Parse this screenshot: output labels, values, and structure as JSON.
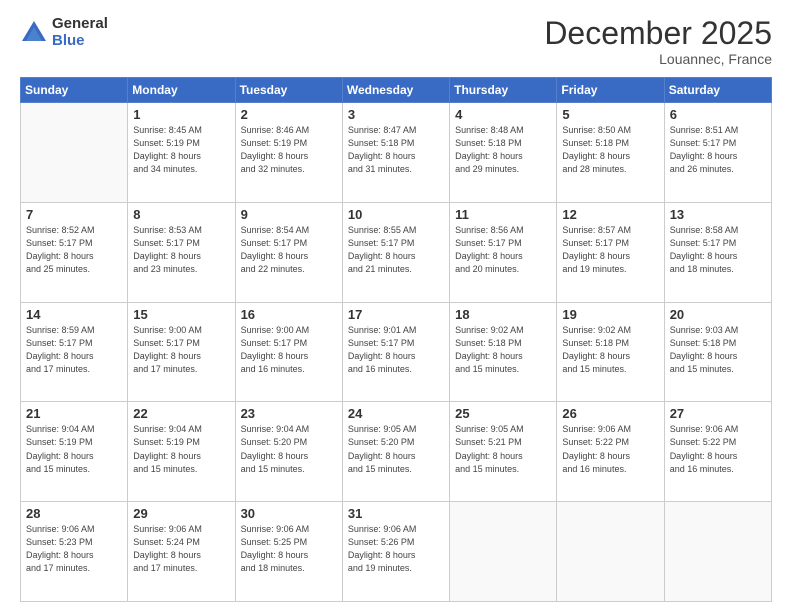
{
  "logo": {
    "general": "General",
    "blue": "Blue"
  },
  "header": {
    "month": "December 2025",
    "location": "Louannec, France"
  },
  "weekdays": [
    "Sunday",
    "Monday",
    "Tuesday",
    "Wednesday",
    "Thursday",
    "Friday",
    "Saturday"
  ],
  "rows": [
    [
      {
        "day": "",
        "info": ""
      },
      {
        "day": "1",
        "info": "Sunrise: 8:45 AM\nSunset: 5:19 PM\nDaylight: 8 hours\nand 34 minutes."
      },
      {
        "day": "2",
        "info": "Sunrise: 8:46 AM\nSunset: 5:19 PM\nDaylight: 8 hours\nand 32 minutes."
      },
      {
        "day": "3",
        "info": "Sunrise: 8:47 AM\nSunset: 5:18 PM\nDaylight: 8 hours\nand 31 minutes."
      },
      {
        "day": "4",
        "info": "Sunrise: 8:48 AM\nSunset: 5:18 PM\nDaylight: 8 hours\nand 29 minutes."
      },
      {
        "day": "5",
        "info": "Sunrise: 8:50 AM\nSunset: 5:18 PM\nDaylight: 8 hours\nand 28 minutes."
      },
      {
        "day": "6",
        "info": "Sunrise: 8:51 AM\nSunset: 5:17 PM\nDaylight: 8 hours\nand 26 minutes."
      }
    ],
    [
      {
        "day": "7",
        "info": "Sunrise: 8:52 AM\nSunset: 5:17 PM\nDaylight: 8 hours\nand 25 minutes."
      },
      {
        "day": "8",
        "info": "Sunrise: 8:53 AM\nSunset: 5:17 PM\nDaylight: 8 hours\nand 23 minutes."
      },
      {
        "day": "9",
        "info": "Sunrise: 8:54 AM\nSunset: 5:17 PM\nDaylight: 8 hours\nand 22 minutes."
      },
      {
        "day": "10",
        "info": "Sunrise: 8:55 AM\nSunset: 5:17 PM\nDaylight: 8 hours\nand 21 minutes."
      },
      {
        "day": "11",
        "info": "Sunrise: 8:56 AM\nSunset: 5:17 PM\nDaylight: 8 hours\nand 20 minutes."
      },
      {
        "day": "12",
        "info": "Sunrise: 8:57 AM\nSunset: 5:17 PM\nDaylight: 8 hours\nand 19 minutes."
      },
      {
        "day": "13",
        "info": "Sunrise: 8:58 AM\nSunset: 5:17 PM\nDaylight: 8 hours\nand 18 minutes."
      }
    ],
    [
      {
        "day": "14",
        "info": "Sunrise: 8:59 AM\nSunset: 5:17 PM\nDaylight: 8 hours\nand 17 minutes."
      },
      {
        "day": "15",
        "info": "Sunrise: 9:00 AM\nSunset: 5:17 PM\nDaylight: 8 hours\nand 17 minutes."
      },
      {
        "day": "16",
        "info": "Sunrise: 9:00 AM\nSunset: 5:17 PM\nDaylight: 8 hours\nand 16 minutes."
      },
      {
        "day": "17",
        "info": "Sunrise: 9:01 AM\nSunset: 5:17 PM\nDaylight: 8 hours\nand 16 minutes."
      },
      {
        "day": "18",
        "info": "Sunrise: 9:02 AM\nSunset: 5:18 PM\nDaylight: 8 hours\nand 15 minutes."
      },
      {
        "day": "19",
        "info": "Sunrise: 9:02 AM\nSunset: 5:18 PM\nDaylight: 8 hours\nand 15 minutes."
      },
      {
        "day": "20",
        "info": "Sunrise: 9:03 AM\nSunset: 5:18 PM\nDaylight: 8 hours\nand 15 minutes."
      }
    ],
    [
      {
        "day": "21",
        "info": "Sunrise: 9:04 AM\nSunset: 5:19 PM\nDaylight: 8 hours\nand 15 minutes."
      },
      {
        "day": "22",
        "info": "Sunrise: 9:04 AM\nSunset: 5:19 PM\nDaylight: 8 hours\nand 15 minutes."
      },
      {
        "day": "23",
        "info": "Sunrise: 9:04 AM\nSunset: 5:20 PM\nDaylight: 8 hours\nand 15 minutes."
      },
      {
        "day": "24",
        "info": "Sunrise: 9:05 AM\nSunset: 5:20 PM\nDaylight: 8 hours\nand 15 minutes."
      },
      {
        "day": "25",
        "info": "Sunrise: 9:05 AM\nSunset: 5:21 PM\nDaylight: 8 hours\nand 15 minutes."
      },
      {
        "day": "26",
        "info": "Sunrise: 9:06 AM\nSunset: 5:22 PM\nDaylight: 8 hours\nand 16 minutes."
      },
      {
        "day": "27",
        "info": "Sunrise: 9:06 AM\nSunset: 5:22 PM\nDaylight: 8 hours\nand 16 minutes."
      }
    ],
    [
      {
        "day": "28",
        "info": "Sunrise: 9:06 AM\nSunset: 5:23 PM\nDaylight: 8 hours\nand 17 minutes."
      },
      {
        "day": "29",
        "info": "Sunrise: 9:06 AM\nSunset: 5:24 PM\nDaylight: 8 hours\nand 17 minutes."
      },
      {
        "day": "30",
        "info": "Sunrise: 9:06 AM\nSunset: 5:25 PM\nDaylight: 8 hours\nand 18 minutes."
      },
      {
        "day": "31",
        "info": "Sunrise: 9:06 AM\nSunset: 5:26 PM\nDaylight: 8 hours\nand 19 minutes."
      },
      {
        "day": "",
        "info": ""
      },
      {
        "day": "",
        "info": ""
      },
      {
        "day": "",
        "info": ""
      }
    ]
  ]
}
